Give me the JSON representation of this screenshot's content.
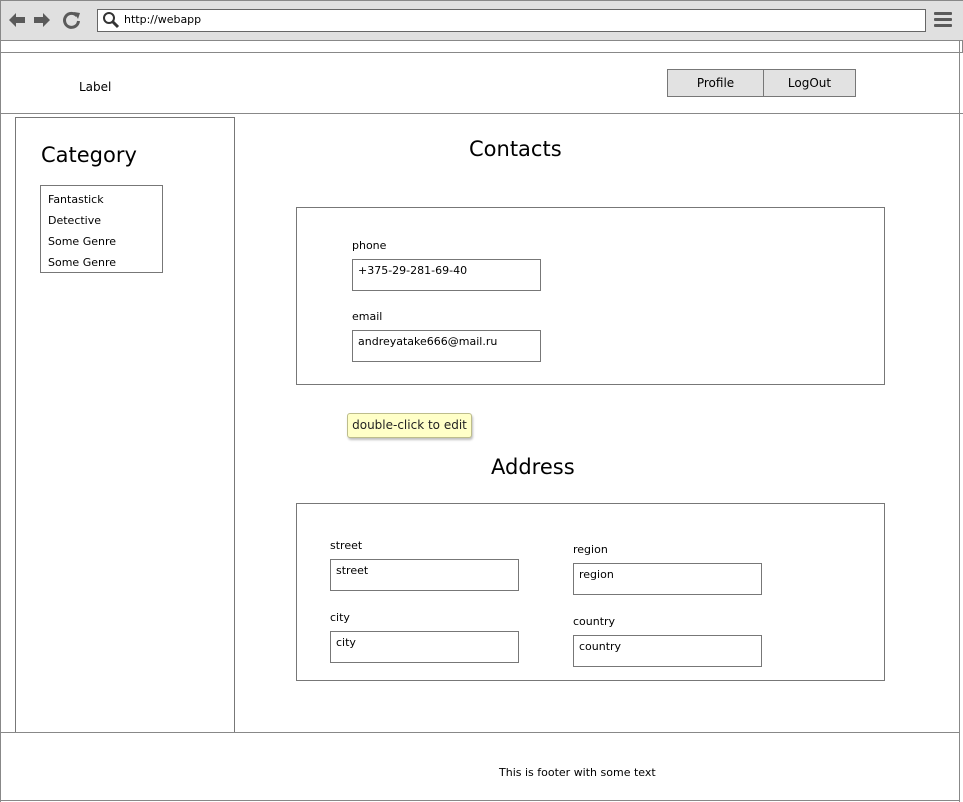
{
  "browser": {
    "url": "http://webapp",
    "back_icon": "arrow-left-icon",
    "forward_icon": "arrow-right-icon",
    "reload_icon": "reload-icon",
    "search_icon": "search-icon",
    "menu_icon": "hamburger-menu-icon"
  },
  "header": {
    "label": "Label",
    "profile_button": "Profile",
    "logout_button": "LogOut"
  },
  "sidebar": {
    "title": "Category",
    "items": [
      {
        "label": "Fantastick"
      },
      {
        "label": "Detective"
      },
      {
        "label": "Some Genre"
      },
      {
        "label": "Some Genre"
      }
    ]
  },
  "contacts": {
    "title": "Contacts",
    "phone_label": "phone",
    "phone_value": "+375-29-281-69-40",
    "email_label": "email",
    "email_value": "andreyatake666@mail.ru"
  },
  "tooltip": {
    "text": "double-click to edit"
  },
  "address": {
    "title": "Address",
    "street_label": "street",
    "street_value": "street",
    "city_label": "city",
    "city_value": "city",
    "region_label": "region",
    "region_value": "region",
    "country_label": "country",
    "country_value": "country"
  },
  "footer": {
    "text": "This is footer with some text"
  }
}
